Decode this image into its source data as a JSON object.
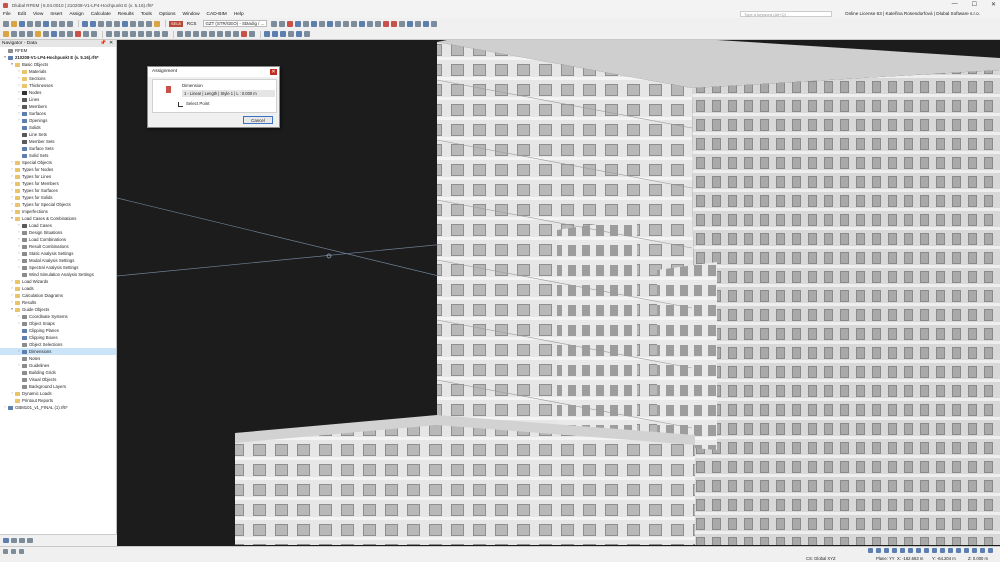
{
  "app": {
    "title": "Dlubal RFEM | 6.04.0010 | 210208-V1-LP4-Hochpunkt E (v. 5.16).rf6*",
    "window_controls": [
      "—",
      "☐",
      "✕"
    ]
  },
  "menu": {
    "items": [
      "File",
      "Edit",
      "View",
      "Insert",
      "Assign",
      "Calculate",
      "Results",
      "Tools",
      "Options",
      "Window",
      "CAD-BIM",
      "Help"
    ],
    "search_placeholder": "Type a keyword (Alt+Q)",
    "license": "Online License 63 | Kateřina Rosendorfová | Dlubal Software s.r.o."
  },
  "toolbar": {
    "badge": "SEL8",
    "rcs_label": "RCS",
    "load_combo": "GZT (STR/GEO) - Ständig / ..."
  },
  "navigator": {
    "title": "Navigator - Data",
    "pin": "📌",
    "close": "✕",
    "rows": [
      {
        "label": "RFEM",
        "level": 0,
        "toggle": "",
        "icon": "gray"
      },
      {
        "label": "210208-V1-LP4-Hochpunkt E (v. 5.16).rf6*",
        "level": 0,
        "toggle": "▾",
        "icon": "blue",
        "bold": true
      },
      {
        "label": "Basic Objects",
        "level": 1,
        "toggle": "▾",
        "icon": "folder"
      },
      {
        "label": "Materials",
        "level": 2,
        "toggle": "›",
        "icon": "folder"
      },
      {
        "label": "Sections",
        "level": 2,
        "toggle": "›",
        "icon": "folder"
      },
      {
        "label": "Thicknesses",
        "level": 2,
        "toggle": "›",
        "icon": "folder"
      },
      {
        "label": "Nodes",
        "level": 2,
        "toggle": "›",
        "icon": "dot"
      },
      {
        "label": "Lines",
        "level": 2,
        "toggle": "›",
        "icon": "line"
      },
      {
        "label": "Members",
        "level": 2,
        "toggle": "›",
        "icon": "line"
      },
      {
        "label": "Surfaces",
        "level": 2,
        "toggle": "›",
        "icon": "blue"
      },
      {
        "label": "Openings",
        "level": 2,
        "toggle": "›",
        "icon": "blue"
      },
      {
        "label": "Solids",
        "level": 2,
        "toggle": "",
        "icon": "blue"
      },
      {
        "label": "Line Sets",
        "level": 2,
        "toggle": "",
        "icon": "line"
      },
      {
        "label": "Member Sets",
        "level": 2,
        "toggle": "",
        "icon": "line"
      },
      {
        "label": "Surface Sets",
        "level": 2,
        "toggle": "",
        "icon": "blue"
      },
      {
        "label": "Solid Sets",
        "level": 2,
        "toggle": "",
        "icon": "blue"
      },
      {
        "label": "Special Objects",
        "level": 1,
        "toggle": "›",
        "icon": "folder"
      },
      {
        "label": "Types for Nodes",
        "level": 1,
        "toggle": "›",
        "icon": "folder"
      },
      {
        "label": "Types for Lines",
        "level": 1,
        "toggle": "›",
        "icon": "folder"
      },
      {
        "label": "Types for Members",
        "level": 1,
        "toggle": "›",
        "icon": "folder"
      },
      {
        "label": "Types for Surfaces",
        "level": 1,
        "toggle": "›",
        "icon": "folder"
      },
      {
        "label": "Types for Solids",
        "level": 1,
        "toggle": "›",
        "icon": "folder"
      },
      {
        "label": "Types for Special Objects",
        "level": 1,
        "toggle": "›",
        "icon": "folder"
      },
      {
        "label": "Imperfections",
        "level": 1,
        "toggle": "›",
        "icon": "folder"
      },
      {
        "label": "Load Cases & Combinations",
        "level": 1,
        "toggle": "▾",
        "icon": "folder"
      },
      {
        "label": "Load Cases",
        "level": 2,
        "toggle": "›",
        "icon": "line"
      },
      {
        "label": "Design Situations",
        "level": 2,
        "toggle": "›",
        "icon": "gray"
      },
      {
        "label": "Load Combinations",
        "level": 2,
        "toggle": "›",
        "icon": "gray"
      },
      {
        "label": "Result Combinations",
        "level": 2,
        "toggle": "›",
        "icon": "gray"
      },
      {
        "label": "Static Analysis Settings",
        "level": 2,
        "toggle": "›",
        "icon": "gray"
      },
      {
        "label": "Modal Analysis Settings",
        "level": 2,
        "toggle": "›",
        "icon": "gray"
      },
      {
        "label": "Spectral Analysis Settings",
        "level": 2,
        "toggle": "›",
        "icon": "gray"
      },
      {
        "label": "Wind Simulation Analysis Settings",
        "level": 2,
        "toggle": "",
        "icon": "gray"
      },
      {
        "label": "Load Wizards",
        "level": 1,
        "toggle": "›",
        "icon": "folder"
      },
      {
        "label": "Loads",
        "level": 1,
        "toggle": "›",
        "icon": "folder"
      },
      {
        "label": "Calculation Diagrams",
        "level": 1,
        "toggle": "›",
        "icon": "folder"
      },
      {
        "label": "Results",
        "level": 1,
        "toggle": "›",
        "icon": "folder"
      },
      {
        "label": "Guide Objects",
        "level": 1,
        "toggle": "▾",
        "icon": "folder"
      },
      {
        "label": "Coordinate Systems",
        "level": 2,
        "toggle": "›",
        "icon": "gray"
      },
      {
        "label": "Object Snaps",
        "level": 2,
        "toggle": "›",
        "icon": "gray"
      },
      {
        "label": "Clipping Planes",
        "level": 2,
        "toggle": "",
        "icon": "blue"
      },
      {
        "label": "Clipping Boxes",
        "level": 2,
        "toggle": "",
        "icon": "blue"
      },
      {
        "label": "Object Selections",
        "level": 2,
        "toggle": "",
        "icon": "gray"
      },
      {
        "label": "Dimensions",
        "level": 2,
        "toggle": "›",
        "icon": "blue",
        "selected": true
      },
      {
        "label": "Notes",
        "level": 2,
        "toggle": "",
        "icon": "gray"
      },
      {
        "label": "Guidelines",
        "level": 2,
        "toggle": "›",
        "icon": "gray"
      },
      {
        "label": "Building Grids",
        "level": 2,
        "toggle": "",
        "icon": "gray"
      },
      {
        "label": "Visual Objects",
        "level": 2,
        "toggle": "",
        "icon": "gray"
      },
      {
        "label": "Background Layers",
        "level": 2,
        "toggle": "",
        "icon": "gray"
      },
      {
        "label": "Dynamic Loads",
        "level": 1,
        "toggle": "›",
        "icon": "folder"
      },
      {
        "label": "Printout Reports",
        "level": 1,
        "toggle": "",
        "icon": "folder"
      },
      {
        "label": "GBM101_v1_FINAL (1).rf6*",
        "level": 0,
        "toggle": "›",
        "icon": "blue"
      }
    ]
  },
  "dialog": {
    "title": "Assignment",
    "close": "✕",
    "dimension_label": "Dimension",
    "dimension_value": "1 - Linear | Length | Style 1 | L : 0.000 m",
    "select_point": "Select Point",
    "cancel": "Cancel"
  },
  "status": {
    "cs": "CS: Global XYZ",
    "plane": "Plane: YY",
    "x": "X: -162.663 m",
    "y": "Y: -64.204 m",
    "z": "Z: 0.000 m"
  },
  "colors": {
    "viewport_bg": "#1c1c1c",
    "selection": "#cce4f7",
    "accent": "#3a73c5"
  }
}
